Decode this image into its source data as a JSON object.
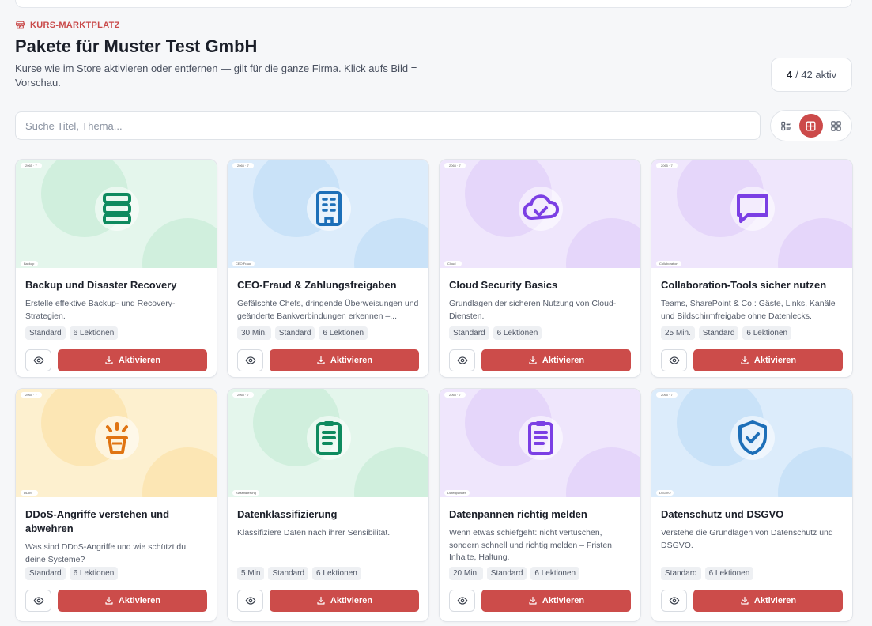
{
  "header": {
    "kicker": "KURS-MARKTPLATZ",
    "title": "Pakete für Muster Test GmbH",
    "subtitle": "Kurse wie im Store aktivieren oder entfernen — gilt für die ganze Firma. Klick aufs Bild = Vorschau.",
    "active_count": "4",
    "active_total": "/ 42 aktiv"
  },
  "search": {
    "placeholder": "Suche Titel, Thema..."
  },
  "view_toggle": {
    "options": [
      "list-view-icon",
      "grid-large-icon",
      "grid-small-icon"
    ],
    "selected": "grid-large-icon"
  },
  "colors": {
    "accent": "#cc4c4a",
    "kicker": "#c94a4a"
  },
  "cards": [
    {
      "title": "Backup und Disaster Recovery",
      "description": "Erstelle effektive Backup- und Recovery-Strategien.",
      "chips": [
        "Standard",
        "6 Lektionen"
      ],
      "icon": "database-icon",
      "theme": [
        "#e4f6ec",
        "#bfe9d2",
        "#0f8a5f"
      ],
      "tag_top": "2065 · 7",
      "tag_bottom": "Backup",
      "action": "Aktivieren"
    },
    {
      "title": "CEO-Fraud & Zahlungsfreigaben",
      "description": "Gefälschte Chefs, dringende Überweisungen und geänderte Bankverbindungen erkennen –...",
      "chips": [
        "30 Min.",
        "Standard",
        "6 Lektionen"
      ],
      "icon": "building-icon",
      "theme": [
        "#dcecfb",
        "#b9dbf6",
        "#1d6fb8"
      ],
      "tag_top": "2065 · 7",
      "tag_bottom": "CEO Fraud",
      "action": "Aktivieren"
    },
    {
      "title": "Cloud Security Basics",
      "description": "Grundlagen der sicheren Nutzung von Cloud-Diensten.",
      "chips": [
        "Standard",
        "6 Lektionen"
      ],
      "icon": "cloud-check-icon",
      "theme": [
        "#efe6fc",
        "#dcc9f8",
        "#7b3fe4"
      ],
      "tag_top": "2065 · 7",
      "tag_bottom": "Cloud",
      "action": "Aktivieren"
    },
    {
      "title": "Collaboration-Tools sicher nutzen",
      "description": "Teams, SharePoint & Co.: Gäste, Links, Kanäle und Bildschirmfreigabe ohne Datenlecks.",
      "chips": [
        "25 Min.",
        "Standard",
        "6 Lektionen"
      ],
      "icon": "chat-bubble-icon",
      "theme": [
        "#efe6fc",
        "#dcc9f8",
        "#7b3fe4"
      ],
      "tag_top": "2065 · 7",
      "tag_bottom": "Collaboration",
      "action": "Aktivieren"
    },
    {
      "title": "DDoS-Angriffe verstehen und abwehren",
      "description": "Was sind DDoS-Angriffe und wie schützt du deine Systeme?",
      "chips": [
        "Standard",
        "6 Lektionen"
      ],
      "icon": "alert-bucket-icon",
      "theme": [
        "#fdf0cf",
        "#fbdf9f",
        "#e07412"
      ],
      "tag_top": "2065 · 7",
      "tag_bottom": "DDoS",
      "action": "Aktivieren"
    },
    {
      "title": "Datenklassifizierung",
      "description": "Klassifiziere Daten nach ihrer Sensibilität.",
      "chips": [
        "5 Min",
        "Standard",
        "6 Lektionen"
      ],
      "icon": "clipboard-icon",
      "theme": [
        "#e4f6ec",
        "#bfe9d2",
        "#0f8a5f"
      ],
      "tag_top": "2065 · 7",
      "tag_bottom": "Klassifizierung",
      "action": "Aktivieren"
    },
    {
      "title": "Datenpannen richtig melden",
      "description": "Wenn etwas schiefgeht: nicht vertuschen, sondern schnell und richtig melden – Fristen, Inhalte, Haltung.",
      "chips": [
        "20 Min.",
        "Standard",
        "6 Lektionen"
      ],
      "icon": "document-icon",
      "theme": [
        "#efe6fc",
        "#dcc9f8",
        "#7b3fe4"
      ],
      "tag_top": "2065 · 7",
      "tag_bottom": "Datenpannen",
      "action": "Aktivieren"
    },
    {
      "title": "Datenschutz und DSGVO",
      "description": "Verstehe die Grundlagen von Datenschutz und DSGVO.",
      "chips": [
        "Standard",
        "6 Lektionen"
      ],
      "icon": "shield-check-icon",
      "theme": [
        "#dcecfb",
        "#b9dbf6",
        "#1d6fb8"
      ],
      "tag_top": "2065 · 7",
      "tag_bottom": "DSGVO",
      "action": "Aktivieren"
    }
  ]
}
